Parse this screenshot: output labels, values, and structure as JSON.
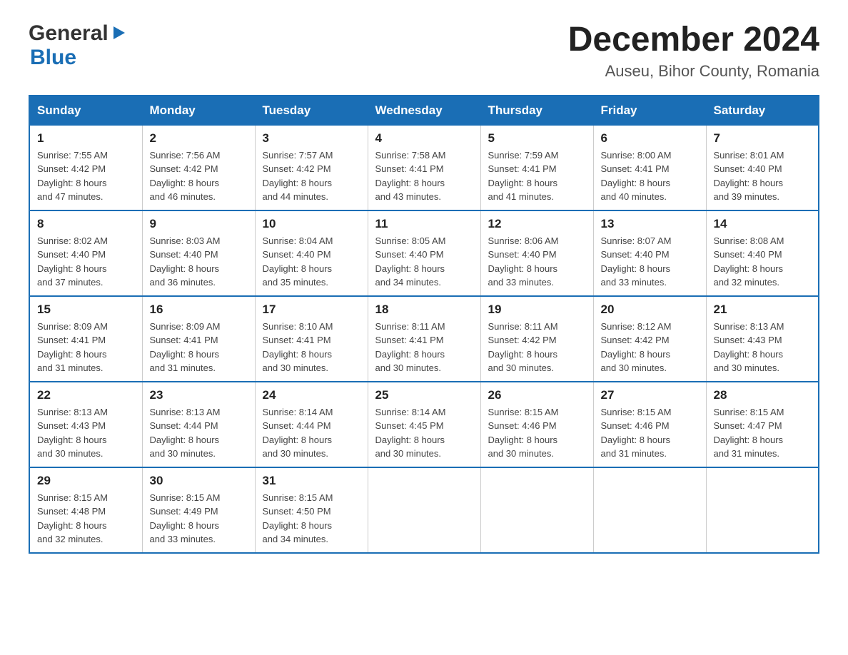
{
  "logo": {
    "general": "General",
    "blue": "Blue",
    "triangle": "▶"
  },
  "title": "December 2024",
  "location": "Auseu, Bihor County, Romania",
  "days_of_week": [
    "Sunday",
    "Monday",
    "Tuesday",
    "Wednesday",
    "Thursday",
    "Friday",
    "Saturday"
  ],
  "weeks": [
    [
      {
        "day": "1",
        "sunrise": "7:55 AM",
        "sunset": "4:42 PM",
        "daylight": "8 hours and 47 minutes."
      },
      {
        "day": "2",
        "sunrise": "7:56 AM",
        "sunset": "4:42 PM",
        "daylight": "8 hours and 46 minutes."
      },
      {
        "day": "3",
        "sunrise": "7:57 AM",
        "sunset": "4:42 PM",
        "daylight": "8 hours and 44 minutes."
      },
      {
        "day": "4",
        "sunrise": "7:58 AM",
        "sunset": "4:41 PM",
        "daylight": "8 hours and 43 minutes."
      },
      {
        "day": "5",
        "sunrise": "7:59 AM",
        "sunset": "4:41 PM",
        "daylight": "8 hours and 41 minutes."
      },
      {
        "day": "6",
        "sunrise": "8:00 AM",
        "sunset": "4:41 PM",
        "daylight": "8 hours and 40 minutes."
      },
      {
        "day": "7",
        "sunrise": "8:01 AM",
        "sunset": "4:40 PM",
        "daylight": "8 hours and 39 minutes."
      }
    ],
    [
      {
        "day": "8",
        "sunrise": "8:02 AM",
        "sunset": "4:40 PM",
        "daylight": "8 hours and 37 minutes."
      },
      {
        "day": "9",
        "sunrise": "8:03 AM",
        "sunset": "4:40 PM",
        "daylight": "8 hours and 36 minutes."
      },
      {
        "day": "10",
        "sunrise": "8:04 AM",
        "sunset": "4:40 PM",
        "daylight": "8 hours and 35 minutes."
      },
      {
        "day": "11",
        "sunrise": "8:05 AM",
        "sunset": "4:40 PM",
        "daylight": "8 hours and 34 minutes."
      },
      {
        "day": "12",
        "sunrise": "8:06 AM",
        "sunset": "4:40 PM",
        "daylight": "8 hours and 33 minutes."
      },
      {
        "day": "13",
        "sunrise": "8:07 AM",
        "sunset": "4:40 PM",
        "daylight": "8 hours and 33 minutes."
      },
      {
        "day": "14",
        "sunrise": "8:08 AM",
        "sunset": "4:40 PM",
        "daylight": "8 hours and 32 minutes."
      }
    ],
    [
      {
        "day": "15",
        "sunrise": "8:09 AM",
        "sunset": "4:41 PM",
        "daylight": "8 hours and 31 minutes."
      },
      {
        "day": "16",
        "sunrise": "8:09 AM",
        "sunset": "4:41 PM",
        "daylight": "8 hours and 31 minutes."
      },
      {
        "day": "17",
        "sunrise": "8:10 AM",
        "sunset": "4:41 PM",
        "daylight": "8 hours and 30 minutes."
      },
      {
        "day": "18",
        "sunrise": "8:11 AM",
        "sunset": "4:41 PM",
        "daylight": "8 hours and 30 minutes."
      },
      {
        "day": "19",
        "sunrise": "8:11 AM",
        "sunset": "4:42 PM",
        "daylight": "8 hours and 30 minutes."
      },
      {
        "day": "20",
        "sunrise": "8:12 AM",
        "sunset": "4:42 PM",
        "daylight": "8 hours and 30 minutes."
      },
      {
        "day": "21",
        "sunrise": "8:13 AM",
        "sunset": "4:43 PM",
        "daylight": "8 hours and 30 minutes."
      }
    ],
    [
      {
        "day": "22",
        "sunrise": "8:13 AM",
        "sunset": "4:43 PM",
        "daylight": "8 hours and 30 minutes."
      },
      {
        "day": "23",
        "sunrise": "8:13 AM",
        "sunset": "4:44 PM",
        "daylight": "8 hours and 30 minutes."
      },
      {
        "day": "24",
        "sunrise": "8:14 AM",
        "sunset": "4:44 PM",
        "daylight": "8 hours and 30 minutes."
      },
      {
        "day": "25",
        "sunrise": "8:14 AM",
        "sunset": "4:45 PM",
        "daylight": "8 hours and 30 minutes."
      },
      {
        "day": "26",
        "sunrise": "8:15 AM",
        "sunset": "4:46 PM",
        "daylight": "8 hours and 30 minutes."
      },
      {
        "day": "27",
        "sunrise": "8:15 AM",
        "sunset": "4:46 PM",
        "daylight": "8 hours and 31 minutes."
      },
      {
        "day": "28",
        "sunrise": "8:15 AM",
        "sunset": "4:47 PM",
        "daylight": "8 hours and 31 minutes."
      }
    ],
    [
      {
        "day": "29",
        "sunrise": "8:15 AM",
        "sunset": "4:48 PM",
        "daylight": "8 hours and 32 minutes."
      },
      {
        "day": "30",
        "sunrise": "8:15 AM",
        "sunset": "4:49 PM",
        "daylight": "8 hours and 33 minutes."
      },
      {
        "day": "31",
        "sunrise": "8:15 AM",
        "sunset": "4:50 PM",
        "daylight": "8 hours and 34 minutes."
      },
      null,
      null,
      null,
      null
    ]
  ],
  "labels": {
    "sunrise": "Sunrise:",
    "sunset": "Sunset:",
    "daylight": "Daylight:"
  }
}
